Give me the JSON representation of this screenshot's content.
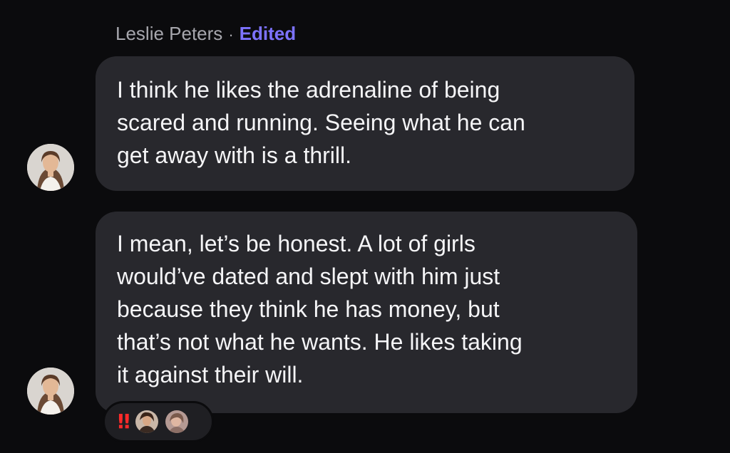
{
  "message_group": {
    "sender_name": "Leslie Peters",
    "separator": "·",
    "edited_label": "Edited",
    "colors": {
      "edited": "#7d73ff",
      "bubble": "#28282d",
      "background": "#0b0b0d"
    }
  },
  "messages": [
    {
      "text": "I think he likes the adrenaline of being\nscared and running. Seeing what he can\nget away with is a thrill.",
      "avatar_icon": "profile-photo-avatar"
    },
    {
      "text": "I mean, let’s be honest. A lot of girls\nwould’ve dated and slept with him just\nbecause they think he has money, but\nthat’s not what he wants. He likes taking\nit against their will.",
      "avatar_icon": "profile-photo-avatar"
    }
  ],
  "reactions": {
    "emoji": "‼",
    "emoji_icon": "double-exclamation-icon",
    "reactor_icons": [
      "reactor-avatar-1",
      "reactor-avatar-2"
    ]
  }
}
